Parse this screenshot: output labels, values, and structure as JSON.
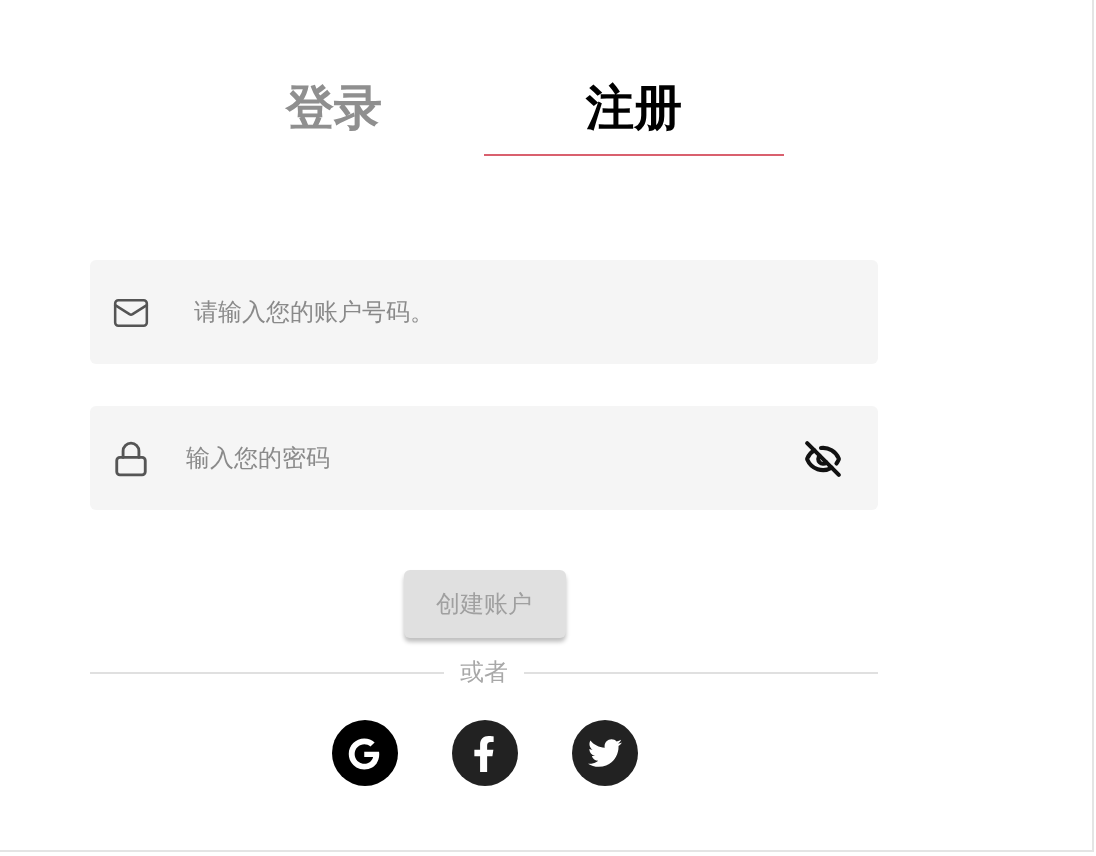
{
  "tabs": [
    {
      "label": "登录",
      "selected": false
    },
    {
      "label": "注册",
      "selected": true
    }
  ],
  "fields": [
    {
      "kind": "email",
      "placeholder": "请输入您的账户号码。"
    },
    {
      "kind": "password",
      "placeholder": "输入您的密码"
    }
  ],
  "submit": {
    "label": "创建账户",
    "disabled": true
  },
  "divider": "或者",
  "social": [
    {
      "kind": "google"
    },
    {
      "kind": "facebook"
    },
    {
      "kind": "twitter"
    }
  ]
}
